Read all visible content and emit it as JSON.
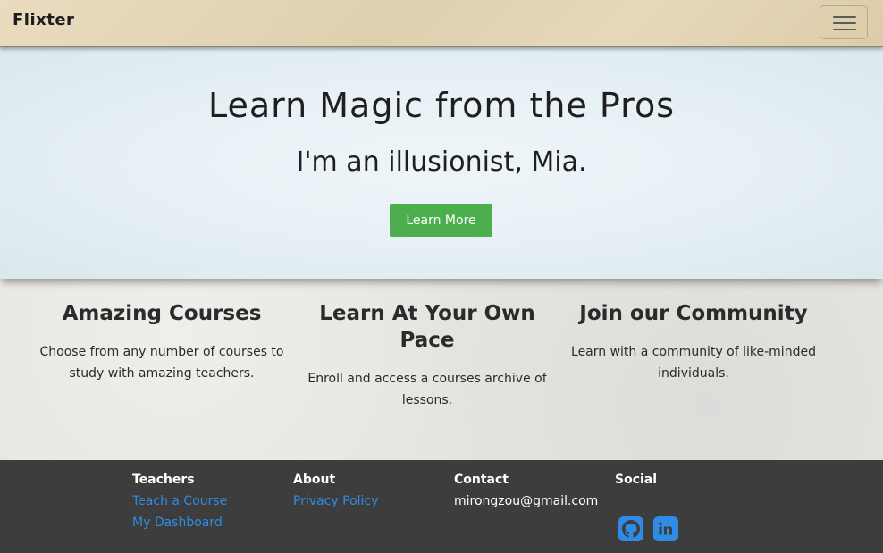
{
  "navbar": {
    "brand": "Flixter",
    "menu_icon": "hamburger-menu-icon"
  },
  "hero": {
    "title": "Learn Magic from the Pros",
    "subtitle": "I'm an illusionist, Mia.",
    "button_label": "Learn More",
    "button_color": "#4cae4c"
  },
  "features": [
    {
      "heading": "Amazing Courses",
      "text": "Choose from any number of courses to study with amazing teachers."
    },
    {
      "heading": "Learn At Your Own Pace",
      "text": "Enroll and access a courses archive of lessons."
    },
    {
      "heading": "Join our Community",
      "text": "Learn with a community of like-minded individuals."
    }
  ],
  "footer": {
    "teachers": {
      "heading": "Teachers",
      "links": [
        "Teach a Course",
        "My Dashboard"
      ]
    },
    "about": {
      "heading": "About",
      "links": [
        "Privacy Policy"
      ]
    },
    "contact": {
      "heading": "Contact",
      "email": "mirongzou@gmail.com"
    },
    "social": {
      "heading": "Social",
      "icons": [
        "github-icon",
        "linkedin-icon"
      ]
    },
    "link_color": "#2f8ce6",
    "background": "#3d3d3d"
  }
}
